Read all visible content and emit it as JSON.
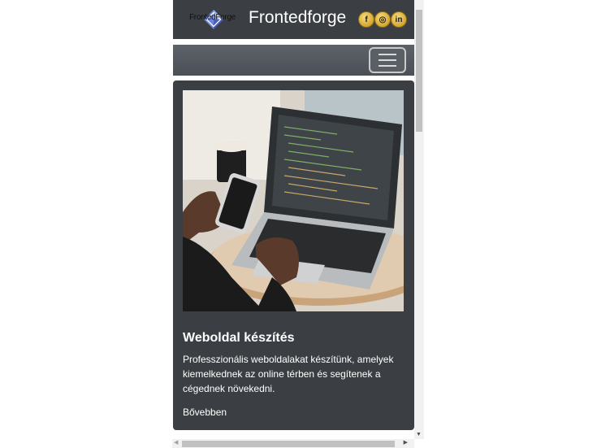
{
  "header": {
    "logo_text": "FrontedForge",
    "site_title": "Frontedforge",
    "social": [
      {
        "icon": "facebook-icon",
        "glyph": "f"
      },
      {
        "icon": "instagram-icon",
        "glyph": "◎"
      },
      {
        "icon": "linkedin-icon",
        "glyph": "in"
      }
    ]
  },
  "navbar": {
    "toggler_icon": "hamburger-menu-icon"
  },
  "card": {
    "image": "laptop-and-phone-photo",
    "title": "Weboldal készítés",
    "text": "Professzionális weboldalakat készítünk, amelyek kiemelkednek az online térben és segítenek a cégednek növekedni.",
    "link": "Bővebben"
  },
  "colors": {
    "header_bg": "#3b3f44",
    "navbar_bg": "#52575d",
    "card_bg": "#3b3f44",
    "social_gold": "#d4a630",
    "text": "#ffffff"
  }
}
